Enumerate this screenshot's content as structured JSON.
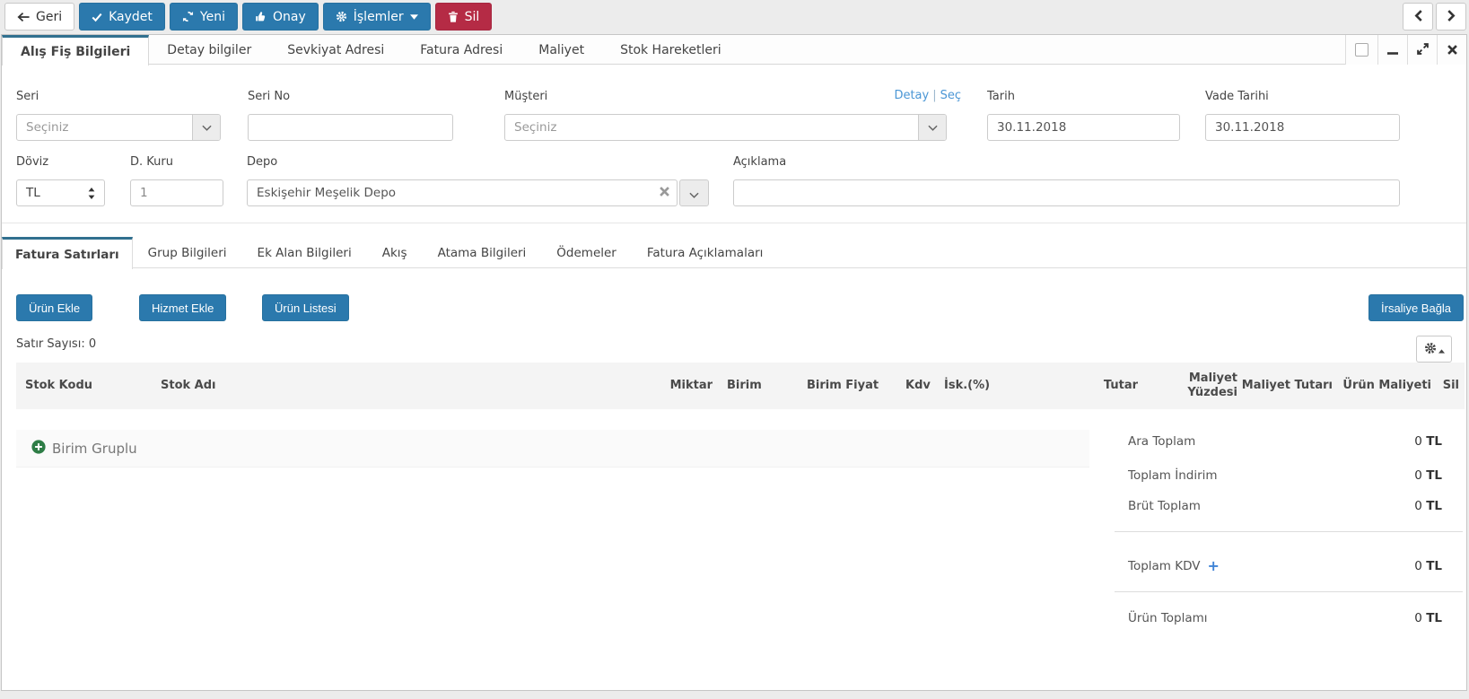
{
  "colors": {
    "primary_button": "#2b79ad",
    "danger_button": "#b52b45",
    "active_tab_border": "#31708f",
    "link": "#4a96d5",
    "group_plus_icon": "#2e7d46",
    "kdv_plus_icon": "#3f83d6"
  },
  "toolbar": {
    "back_label": "Geri",
    "save_label": "Kaydet",
    "new_label": "Yeni",
    "approve_label": "Onay",
    "actions_label": "İşlemler",
    "delete_label": "Sil"
  },
  "main_tabs": [
    "Alış Fiş Bilgileri",
    "Detay bilgiler",
    "Sevkiyat Adresi",
    "Fatura Adresi",
    "Maliyet",
    "Stok Hareketleri"
  ],
  "form": {
    "seri": {
      "label": "Seri",
      "value": "Seçiniz"
    },
    "seri_no": {
      "label": "Seri No",
      "value": ""
    },
    "musteri": {
      "label": "Müşteri",
      "value": "Seçiniz",
      "detay_link": "Detay",
      "link_separator": "|",
      "sec_link": "Seç"
    },
    "tarih": {
      "label": "Tarih",
      "value": "30.11.2018"
    },
    "vade_tarihi": {
      "label": "Vade Tarihi",
      "value": "30.11.2018"
    },
    "doviz": {
      "label": "Döviz",
      "value": "TL"
    },
    "d_kuru": {
      "label": "D. Kuru",
      "value": "1"
    },
    "depo": {
      "label": "Depo",
      "value": "Eskişehir Meşelik Depo"
    },
    "aciklama": {
      "label": "Açıklama",
      "value": ""
    }
  },
  "sub_tabs": [
    "Fatura Satırları",
    "Grup Bilgileri",
    "Ek Alan Bilgileri",
    "Akış",
    "Atama Bilgileri",
    "Ödemeler",
    "Fatura Açıklamaları"
  ],
  "line_toolbar": {
    "urun_ekle": "Ürün Ekle",
    "hizmet_ekle": "Hizmet Ekle",
    "urun_listesi": "Ürün Listesi",
    "irsaliye_bagla": "İrsaliye Bağla",
    "row_count": "Satır Sayısı: 0"
  },
  "table": {
    "headers": [
      "Stok Kodu",
      "Stok Adı",
      "Miktar",
      "Birim",
      "Birim Fiyat",
      "Kdv",
      "İsk.(%)",
      "Tutar",
      "Maliyet Yüzdesi",
      "Maliyet Tutarı",
      "Ürün Maliyeti",
      "Sil"
    ],
    "group_row_label": "Birim Gruplu"
  },
  "totals": [
    {
      "label": "Ara Toplam",
      "value": "0",
      "currency": "TL"
    },
    {
      "label": "Toplam İndirim",
      "value": "0",
      "currency": "TL"
    },
    {
      "label": "Brüt Toplam",
      "value": "0",
      "currency": "TL"
    },
    {
      "label": "Toplam KDV",
      "plus": "+",
      "value": "0",
      "currency": "TL"
    },
    {
      "label": "Ürün Toplamı",
      "value": "0",
      "currency": "TL"
    }
  ]
}
